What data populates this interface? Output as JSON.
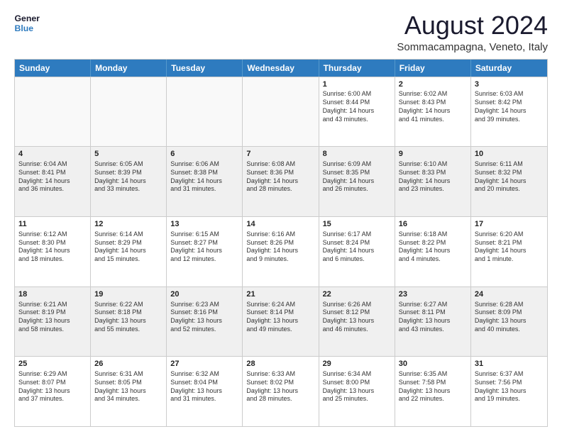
{
  "logo": {
    "line1": "General",
    "line2": "Blue"
  },
  "title": "August 2024",
  "subtitle": "Sommacampagna, Veneto, Italy",
  "days": [
    "Sunday",
    "Monday",
    "Tuesday",
    "Wednesday",
    "Thursday",
    "Friday",
    "Saturday"
  ],
  "weeks": [
    [
      {
        "day": "",
        "content": ""
      },
      {
        "day": "",
        "content": ""
      },
      {
        "day": "",
        "content": ""
      },
      {
        "day": "",
        "content": ""
      },
      {
        "day": "1",
        "content": "Sunrise: 6:00 AM\nSunset: 8:44 PM\nDaylight: 14 hours\nand 43 minutes."
      },
      {
        "day": "2",
        "content": "Sunrise: 6:02 AM\nSunset: 8:43 PM\nDaylight: 14 hours\nand 41 minutes."
      },
      {
        "day": "3",
        "content": "Sunrise: 6:03 AM\nSunset: 8:42 PM\nDaylight: 14 hours\nand 39 minutes."
      }
    ],
    [
      {
        "day": "4",
        "content": "Sunrise: 6:04 AM\nSunset: 8:41 PM\nDaylight: 14 hours\nand 36 minutes."
      },
      {
        "day": "5",
        "content": "Sunrise: 6:05 AM\nSunset: 8:39 PM\nDaylight: 14 hours\nand 33 minutes."
      },
      {
        "day": "6",
        "content": "Sunrise: 6:06 AM\nSunset: 8:38 PM\nDaylight: 14 hours\nand 31 minutes."
      },
      {
        "day": "7",
        "content": "Sunrise: 6:08 AM\nSunset: 8:36 PM\nDaylight: 14 hours\nand 28 minutes."
      },
      {
        "day": "8",
        "content": "Sunrise: 6:09 AM\nSunset: 8:35 PM\nDaylight: 14 hours\nand 26 minutes."
      },
      {
        "day": "9",
        "content": "Sunrise: 6:10 AM\nSunset: 8:33 PM\nDaylight: 14 hours\nand 23 minutes."
      },
      {
        "day": "10",
        "content": "Sunrise: 6:11 AM\nSunset: 8:32 PM\nDaylight: 14 hours\nand 20 minutes."
      }
    ],
    [
      {
        "day": "11",
        "content": "Sunrise: 6:12 AM\nSunset: 8:30 PM\nDaylight: 14 hours\nand 18 minutes."
      },
      {
        "day": "12",
        "content": "Sunrise: 6:14 AM\nSunset: 8:29 PM\nDaylight: 14 hours\nand 15 minutes."
      },
      {
        "day": "13",
        "content": "Sunrise: 6:15 AM\nSunset: 8:27 PM\nDaylight: 14 hours\nand 12 minutes."
      },
      {
        "day": "14",
        "content": "Sunrise: 6:16 AM\nSunset: 8:26 PM\nDaylight: 14 hours\nand 9 minutes."
      },
      {
        "day": "15",
        "content": "Sunrise: 6:17 AM\nSunset: 8:24 PM\nDaylight: 14 hours\nand 6 minutes."
      },
      {
        "day": "16",
        "content": "Sunrise: 6:18 AM\nSunset: 8:22 PM\nDaylight: 14 hours\nand 4 minutes."
      },
      {
        "day": "17",
        "content": "Sunrise: 6:20 AM\nSunset: 8:21 PM\nDaylight: 14 hours\nand 1 minute."
      }
    ],
    [
      {
        "day": "18",
        "content": "Sunrise: 6:21 AM\nSunset: 8:19 PM\nDaylight: 13 hours\nand 58 minutes."
      },
      {
        "day": "19",
        "content": "Sunrise: 6:22 AM\nSunset: 8:18 PM\nDaylight: 13 hours\nand 55 minutes."
      },
      {
        "day": "20",
        "content": "Sunrise: 6:23 AM\nSunset: 8:16 PM\nDaylight: 13 hours\nand 52 minutes."
      },
      {
        "day": "21",
        "content": "Sunrise: 6:24 AM\nSunset: 8:14 PM\nDaylight: 13 hours\nand 49 minutes."
      },
      {
        "day": "22",
        "content": "Sunrise: 6:26 AM\nSunset: 8:12 PM\nDaylight: 13 hours\nand 46 minutes."
      },
      {
        "day": "23",
        "content": "Sunrise: 6:27 AM\nSunset: 8:11 PM\nDaylight: 13 hours\nand 43 minutes."
      },
      {
        "day": "24",
        "content": "Sunrise: 6:28 AM\nSunset: 8:09 PM\nDaylight: 13 hours\nand 40 minutes."
      }
    ],
    [
      {
        "day": "25",
        "content": "Sunrise: 6:29 AM\nSunset: 8:07 PM\nDaylight: 13 hours\nand 37 minutes."
      },
      {
        "day": "26",
        "content": "Sunrise: 6:31 AM\nSunset: 8:05 PM\nDaylight: 13 hours\nand 34 minutes."
      },
      {
        "day": "27",
        "content": "Sunrise: 6:32 AM\nSunset: 8:04 PM\nDaylight: 13 hours\nand 31 minutes."
      },
      {
        "day": "28",
        "content": "Sunrise: 6:33 AM\nSunset: 8:02 PM\nDaylight: 13 hours\nand 28 minutes."
      },
      {
        "day": "29",
        "content": "Sunrise: 6:34 AM\nSunset: 8:00 PM\nDaylight: 13 hours\nand 25 minutes."
      },
      {
        "day": "30",
        "content": "Sunrise: 6:35 AM\nSunset: 7:58 PM\nDaylight: 13 hours\nand 22 minutes."
      },
      {
        "day": "31",
        "content": "Sunrise: 6:37 AM\nSunset: 7:56 PM\nDaylight: 13 hours\nand 19 minutes."
      }
    ]
  ],
  "shadedRows": [
    1,
    3
  ],
  "colors": {
    "header_bg": "#2e7bbf",
    "shaded_bg": "#f0f0f0",
    "white_bg": "#ffffff"
  }
}
